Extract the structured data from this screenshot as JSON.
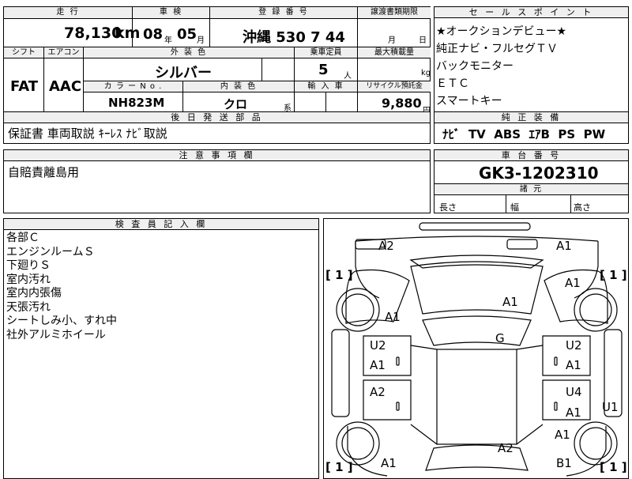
{
  "header_row": {
    "mileage_label": "走 行",
    "mileage_value": "78,130",
    "mileage_unit": "km",
    "inspection_label": "車 検",
    "inspection_year": "08",
    "inspection_year_unit": "年",
    "inspection_month": "05",
    "inspection_month_unit": "月",
    "registration_label": "登 録 番 号",
    "registration_value": "沖縄 530 7 44",
    "transfer_label": "譲渡書類期限",
    "transfer_month_unit": "月",
    "transfer_day_unit": "日"
  },
  "spec_row": {
    "shift_label": "シフト",
    "shift_value": "FAT",
    "ac_label": "エアコン",
    "ac_value": "AAC",
    "exterior_label": "外 装 色",
    "exterior_value": "シルバー",
    "capacity_label": "乗車定員",
    "capacity_value": "5",
    "capacity_unit": "人",
    "max_load_label": "最大積載量",
    "max_load_unit": "kg",
    "color_no_label": "カ ラ ー N o .",
    "color_no_value": "NH823M",
    "interior_label": "内 装 色",
    "interior_value": "クロ",
    "interior_unit": "系",
    "import_label": "輸 入 車",
    "recycle_label": "リサイクル預託金",
    "recycle_value": "9,880",
    "recycle_unit": "円"
  },
  "documents": {
    "label": "後 日 発 送 部 品",
    "value": "保証書 車両取説 ｷｰﾚｽ ﾅﾋﾞ取説"
  },
  "notes": {
    "label": "注 意 事 項 欄",
    "value": "自賠責離島用"
  },
  "sales_points": {
    "label": "セ ー ル ス ポ イ ン ト",
    "items": [
      "★オークションデビュー★",
      "純正ナビ・フルセグＴＶ",
      "バックモニター",
      "ＥＴＣ",
      "スマートキー"
    ]
  },
  "genuine_equipment": {
    "label": "純 正 装 備",
    "value": "ﾅﾋﾞ  TV  ABS  ｴｱB  PS  PW"
  },
  "chassis": {
    "label": "車 台 番 号",
    "value": "GK3-1202310"
  },
  "dimensions": {
    "label": "諸 元",
    "length_label": "長さ",
    "width_label": "幅",
    "height_label": "高さ"
  },
  "inspector": {
    "label": "検 査 員 記 入 欄",
    "lines": [
      "各部Ｃ",
      "エンジンルームＳ",
      "下廻りＳ",
      "室内汚れ",
      "室内内張傷",
      "天張汚れ",
      "シートしみ小、すれ中",
      "社外アルミホイール"
    ]
  },
  "diagram": {
    "marks": [
      {
        "id": "front-left-corner",
        "text": "A2"
      },
      {
        "id": "front-right-corner",
        "text": "A1"
      },
      {
        "id": "hood",
        "text": "A1"
      },
      {
        "id": "right-fender-front",
        "text": "A1"
      },
      {
        "id": "left-fender-front",
        "text": "A1"
      },
      {
        "id": "windshield",
        "text": "G"
      },
      {
        "id": "left-front-door-u",
        "text": "U2"
      },
      {
        "id": "left-front-door-a",
        "text": "A1"
      },
      {
        "id": "right-front-door-u",
        "text": "U2"
      },
      {
        "id": "right-front-door-a",
        "text": "A1"
      },
      {
        "id": "left-rear-door",
        "text": "A2"
      },
      {
        "id": "right-rear-door-u",
        "text": "U4"
      },
      {
        "id": "right-rear-door-a",
        "text": "A1"
      },
      {
        "id": "right-step",
        "text": "U1"
      },
      {
        "id": "right-quarter",
        "text": "A1"
      },
      {
        "id": "roof-rear",
        "text": "A2"
      },
      {
        "id": "left-rear-corner",
        "text": "A1"
      },
      {
        "id": "right-rear-corner",
        "text": "B1"
      }
    ],
    "tire_brackets": [
      "[ 1 ]",
      "[ 1 ]",
      "[ 1 ]",
      "[ 1 ]"
    ]
  }
}
